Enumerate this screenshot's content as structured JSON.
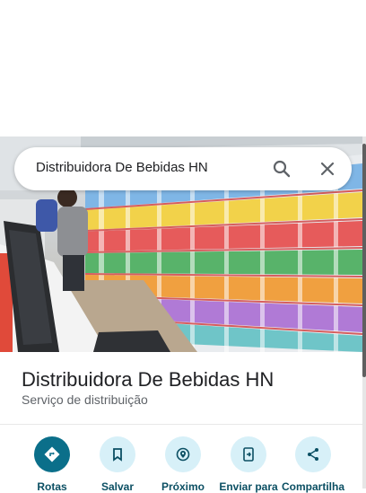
{
  "search": {
    "query": "Distribuidora De Bebidas HN"
  },
  "place": {
    "name": "Distribuidora De Bebidas HN",
    "category": "Serviço de distribuição"
  },
  "actions": [
    {
      "label": "Rotas",
      "icon": "directions-icon"
    },
    {
      "label": "Salvar",
      "icon": "bookmark-icon"
    },
    {
      "label": "Próximo",
      "icon": "nearby-icon"
    },
    {
      "label": "Enviar para",
      "icon": "send-to-phone-icon"
    },
    {
      "label": "Compartilha",
      "icon": "share-icon"
    }
  ],
  "colors": {
    "accent": "#0b6f8a",
    "chip_bg": "#d7f0f8",
    "title": "#202124",
    "subtitle": "#5f6368"
  }
}
